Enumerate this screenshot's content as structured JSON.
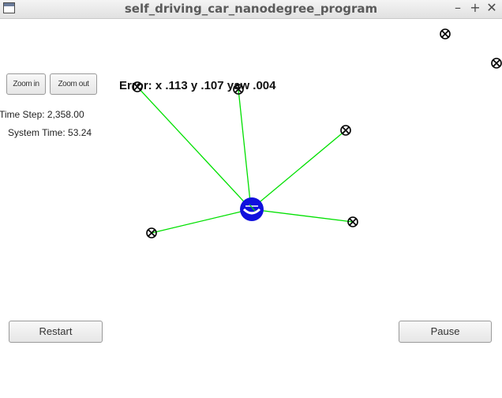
{
  "window": {
    "title": "self_driving_car_nanodegree_program",
    "controls": {
      "minimize_icon": "–",
      "maximize_icon": "+",
      "close_icon": "✕"
    }
  },
  "controls": {
    "zoom_in_label": "Zoom in",
    "zoom_out_label": "Zoom out",
    "restart_label": "Restart",
    "pause_label": "Pause"
  },
  "info": {
    "time_step": "Time Step: 2,358.00",
    "system_time": "System Time: 53.24"
  },
  "error_label": "Error: x .113 y .107 yaw .004",
  "colors": {
    "observation_line": "#00e000",
    "vehicle": "#1010dd",
    "landmark": "#000000"
  },
  "icons": {
    "vehicle": "car-marker",
    "landmark": "crossed-circle"
  }
}
